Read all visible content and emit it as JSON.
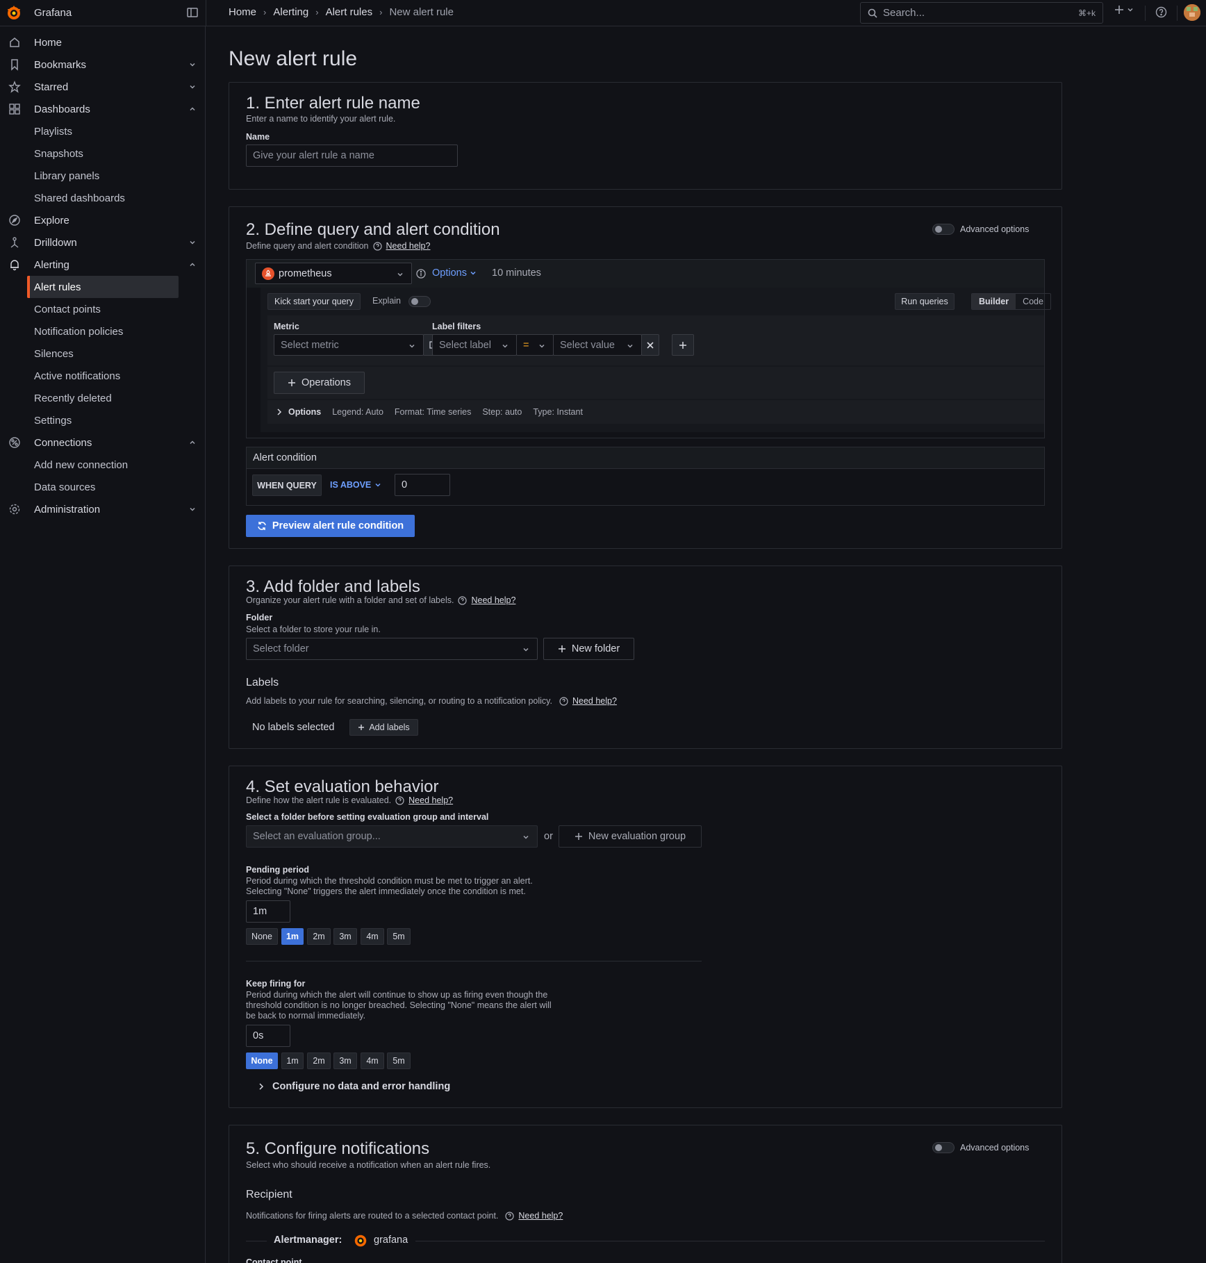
{
  "app": {
    "name": "Grafana"
  },
  "breadcrumbs": [
    "Home",
    "Alerting",
    "Alert rules",
    "New alert rule"
  ],
  "search": {
    "placeholder": "Search...",
    "shortcut": "⌘+k"
  },
  "sidebar": {
    "items": [
      {
        "label": "Home"
      },
      {
        "label": "Bookmarks"
      },
      {
        "label": "Starred"
      },
      {
        "label": "Dashboards"
      },
      {
        "label": "Playlists"
      },
      {
        "label": "Snapshots"
      },
      {
        "label": "Library panels"
      },
      {
        "label": "Shared dashboards"
      },
      {
        "label": "Explore"
      },
      {
        "label": "Drilldown"
      },
      {
        "label": "Alerting"
      },
      {
        "label": "Alert rules"
      },
      {
        "label": "Contact points"
      },
      {
        "label": "Notification policies"
      },
      {
        "label": "Silences"
      },
      {
        "label": "Active notifications"
      },
      {
        "label": "Recently deleted"
      },
      {
        "label": "Settings"
      },
      {
        "label": "Connections"
      },
      {
        "label": "Add new connection"
      },
      {
        "label": "Data sources"
      },
      {
        "label": "Administration"
      }
    ]
  },
  "page": {
    "title": "New alert rule"
  },
  "s1": {
    "title": "1. Enter alert rule name",
    "desc": "Enter a name to identify your alert rule.",
    "name_label": "Name",
    "name_placeholder": "Give your alert rule a name"
  },
  "s2": {
    "title": "2. Define query and alert condition",
    "desc": "Define query and alert condition",
    "help": "Need help?",
    "advanced": "Advanced options",
    "datasource": "prometheus",
    "options": "Options",
    "time_range": "10 minutes",
    "kick_start": "Kick start your query",
    "explain": "Explain",
    "run_queries": "Run queries",
    "mode_builder": "Builder",
    "mode_code": "Code",
    "metric_label": "Metric",
    "metric_placeholder": "Select metric",
    "label_filters": "Label filters",
    "select_label": "Select label",
    "operator": "=",
    "select_value": "Select value",
    "operations": "Operations",
    "opts_title": "Options",
    "opt_legend": "Legend: Auto",
    "opt_format": "Format: Time series",
    "opt_step": "Step: auto",
    "opt_type": "Type: Instant",
    "cond_title": "Alert condition",
    "when_query": "WHEN QUERY",
    "is_above": "IS ABOVE",
    "threshold": "0",
    "preview": "Preview alert rule condition"
  },
  "s3": {
    "title": "3. Add folder and labels",
    "desc": "Organize your alert rule with a folder and set of labels.",
    "help": "Need help?",
    "folder_label": "Folder",
    "folder_desc": "Select a folder to store your rule in.",
    "folder_placeholder": "Select folder",
    "new_folder": "New folder",
    "labels_title": "Labels",
    "labels_desc": "Add labels to your rule for searching, silencing, or routing to a notification policy.",
    "labels_help": "Need help?",
    "no_labels": "No labels selected",
    "add_labels": "Add labels"
  },
  "s4": {
    "title": "4. Set evaluation behavior",
    "desc": "Define how the alert rule is evaluated.",
    "help": "Need help?",
    "group_label": "Select a folder before setting evaluation group and interval",
    "group_placeholder": "Select an evaluation group...",
    "or": "or",
    "new_group": "New evaluation group",
    "pending_label": "Pending period",
    "pending_desc1": "Period during which the threshold condition must be met to trigger an alert.",
    "pending_desc2": "Selecting \"None\" triggers the alert immediately once the condition is met.",
    "pending_value": "1m",
    "pending_chips": [
      "None",
      "1m",
      "2m",
      "3m",
      "4m",
      "5m"
    ],
    "keep_label": "Keep firing for",
    "keep_desc1": "Period during which the alert will continue to show up as firing even though the",
    "keep_desc2": "threshold condition is no longer breached. Selecting \"None\" means the alert will",
    "keep_desc3": "be back to normal immediately.",
    "keep_value": "0s",
    "keep_chips": [
      "None",
      "1m",
      "2m",
      "3m",
      "4m",
      "5m"
    ],
    "nodata": "Configure no data and error handling"
  },
  "s5": {
    "title": "5. Configure notifications",
    "desc": "Select who should receive a notification when an alert rule fires.",
    "advanced": "Advanced options",
    "recipient": "Recipient",
    "recipient_desc": "Notifications for firing alerts are routed to a selected contact point.",
    "help": "Need help?",
    "am_label": "Alertmanager:",
    "am_value": "grafana",
    "contact_point": "Contact point"
  },
  "colors": {
    "accent": "#3d71d9",
    "brand": "#f05a28",
    "background": "#111217"
  }
}
